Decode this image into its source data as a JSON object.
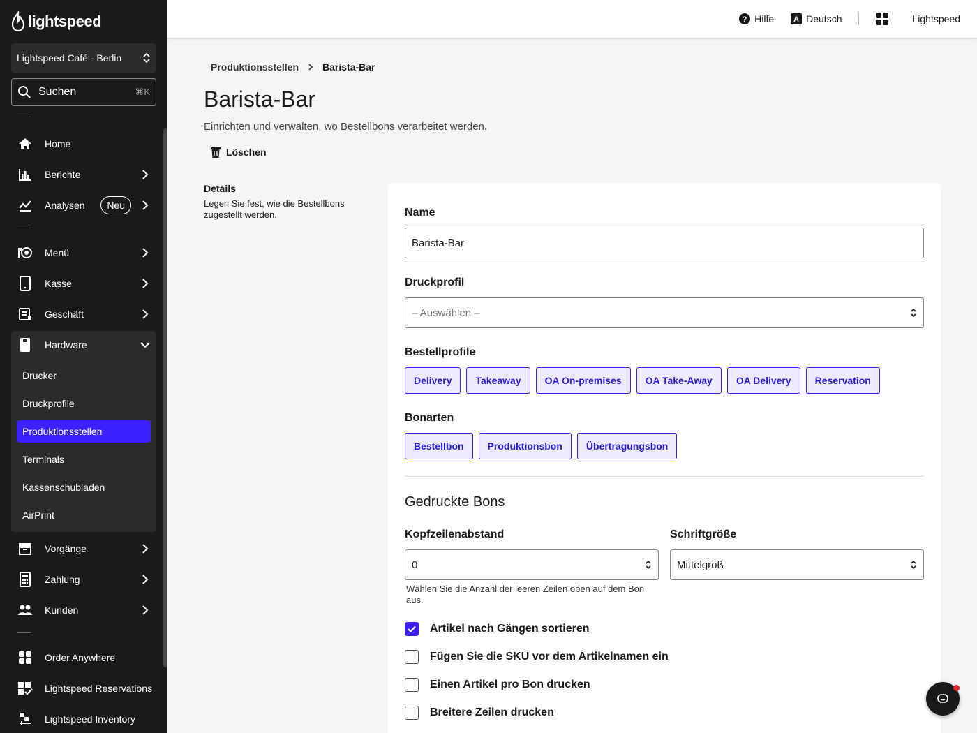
{
  "brand": {
    "name": "lightspeed"
  },
  "sidebar": {
    "store": "Lightspeed Café - Berlin",
    "search": {
      "label": "Suchen",
      "shortcut": "⌘K"
    },
    "items": [
      {
        "label": "Home",
        "icon": "home-icon"
      },
      {
        "label": "Berichte",
        "icon": "reports-icon"
      },
      {
        "label": "Analysen",
        "icon": "analytics-icon",
        "badge": "Neu"
      },
      {
        "label": "Menü",
        "icon": "menu-icon"
      },
      {
        "label": "Kasse",
        "icon": "tablet-icon"
      },
      {
        "label": "Geschäft",
        "icon": "business-icon"
      },
      {
        "label": "Hardware",
        "icon": "hardware-icon"
      },
      {
        "label": "Vorgänge",
        "icon": "archive-icon"
      },
      {
        "label": "Zahlung",
        "icon": "calculator-icon"
      },
      {
        "label": "Kunden",
        "icon": "customers-icon"
      },
      {
        "label": "Order Anywhere",
        "icon": "order-anywhere-icon"
      },
      {
        "label": "Lightspeed Reservations",
        "icon": "reservations-icon"
      },
      {
        "label": "Lightspeed Inventory",
        "icon": "inventory-icon"
      }
    ],
    "hardware_sub": [
      "Drucker",
      "Druckprofile",
      "Produktionsstellen",
      "Terminals",
      "Kassenschubladen",
      "AirPrint"
    ],
    "active_sub": "Produktionsstellen"
  },
  "topbar": {
    "help": "Hilfe",
    "language": "Deutsch",
    "account": "Lightspeed"
  },
  "breadcrumb": {
    "parent": "Produktionsstellen",
    "current": "Barista-Bar"
  },
  "page": {
    "title": "Barista-Bar",
    "subtitle": "Einrichten und verwalten, wo Bestellbons verarbeitet werden.",
    "delete_label": "Löschen"
  },
  "details": {
    "title": "Details",
    "description": "Legen Sie fest, wie die Bestellbons zugestellt werden."
  },
  "form": {
    "name_label": "Name",
    "name_value": "Barista-Bar",
    "print_profile_label": "Druckprofil",
    "print_profile_placeholder": "– Auswählen –",
    "order_profiles_label": "Bestellprofile",
    "order_profiles": [
      "Delivery",
      "Takeaway",
      "OA On-premises",
      "OA Take-Away",
      "OA Delivery",
      "Reservation"
    ],
    "ticket_types_label": "Bonarten",
    "ticket_types": [
      "Bestellbon",
      "Produktionsbon",
      "Übertragungsbon"
    ],
    "printed_section": "Gedruckte Bons",
    "header_spacing_label": "Kopfzeilenabstand",
    "header_spacing_value": "0",
    "header_spacing_help": "Wählen Sie die Anzahl der leeren Zeilen oben auf dem Bon aus.",
    "font_size_label": "Schriftgröße",
    "font_size_value": "Mittelgroß",
    "checkboxes": [
      {
        "label": "Artikel nach Gängen sortieren",
        "checked": true
      },
      {
        "label": "Fügen Sie die SKU vor dem Artikelnamen ein",
        "checked": false
      },
      {
        "label": "Einen Artikel pro Bon drucken",
        "checked": false
      },
      {
        "label": "Breitere Zeilen drucken",
        "checked": false
      }
    ]
  },
  "colors": {
    "accent": "#3d20ff",
    "sidebar_bg": "#1a1a1a",
    "chip_bg": "#eeeaff"
  }
}
